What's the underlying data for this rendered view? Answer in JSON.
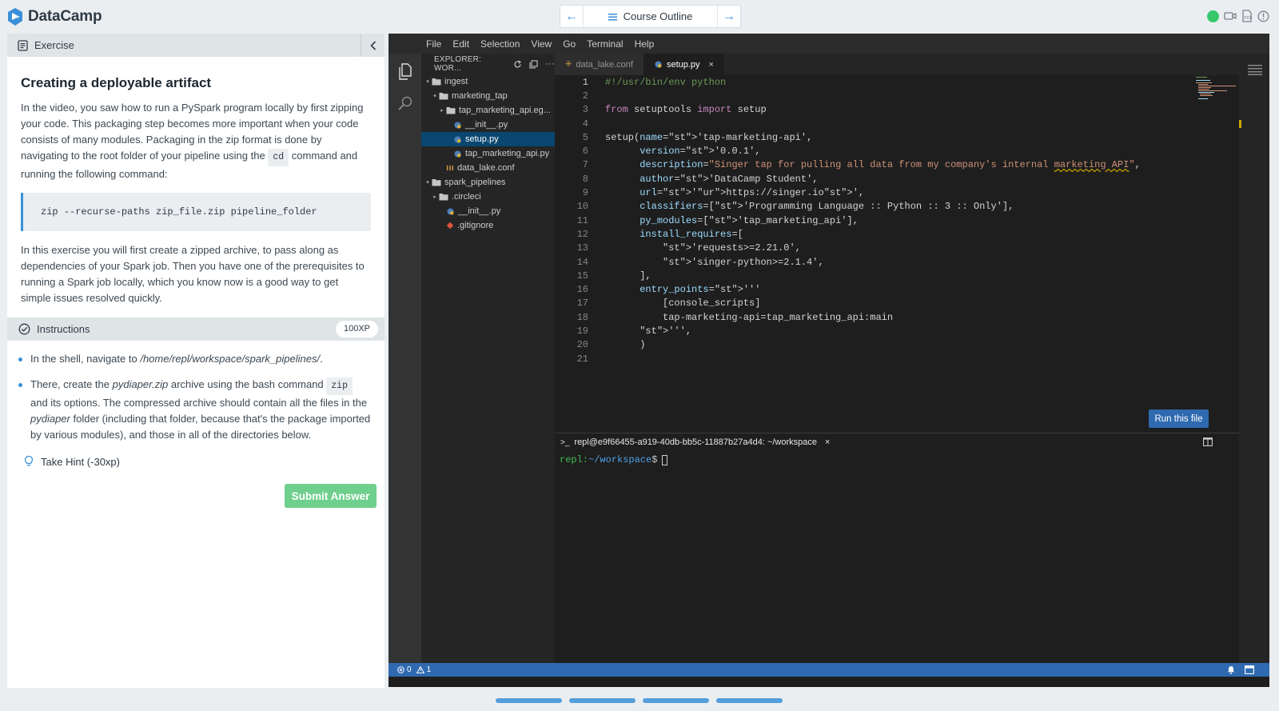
{
  "brand": {
    "name": "DataCamp",
    "accent": "#3a8fd8"
  },
  "topnav": {
    "course_outline": "Course Outline",
    "prev_icon": "arrow-left-icon",
    "next_icon": "arrow-right-icon"
  },
  "exercise": {
    "header": "Exercise",
    "title": "Creating a deployable artifact",
    "intro_parts": [
      "In the video, you saw how to run a PySpark program locally by first zipping your code. This packaging step becomes more important when your code consists of many modules. Packaging in the zip format is done by navigating to the root folder of your pipeline using the",
      "cd",
      "command and running the following command:"
    ],
    "command": "zip --recurse-paths zip_file.zip pipeline_folder",
    "body": "In this exercise you will first create a zipped archive, to pass along as dependencies of your Spark job. Then you have one of the prerequisites to running a Spark job locally, which you know now is a good way to get simple issues resolved quickly."
  },
  "instructions": {
    "header": "Instructions",
    "xp": "100XP",
    "b1_pre": "In the shell, navigate to",
    "b1_path": "/home/repl/workspace/spark_pipelines/",
    "b1_post": ".",
    "b2_a": "There, create the",
    "b2_file": "pydiaper.zip",
    "b2_b": "archive using the bash command",
    "b2_code": "zip",
    "b2_c": "and its options. The compressed archive should contain all the files in the",
    "b2_folder": "pydiaper",
    "b2_d": "folder (including that folder, because that's the package imported by various modules), and those in all of the directories below.",
    "hint": "Take Hint (-30xp)",
    "submit": "Submit Answer"
  },
  "ide": {
    "menu": [
      "File",
      "Edit",
      "Selection",
      "View",
      "Go",
      "Terminal",
      "Help"
    ],
    "explorer_title": "EXPLORER: WOR...",
    "tree": [
      {
        "label": "ingest",
        "indent": 0,
        "twisty": "▾",
        "type": "folder"
      },
      {
        "label": "marketing_tap",
        "indent": 1,
        "twisty": "▾",
        "type": "folder"
      },
      {
        "label": "tap_marketing_api.eg...",
        "indent": 2,
        "twisty": "▸",
        "type": "folder"
      },
      {
        "label": "__init__.py",
        "indent": 3,
        "twisty": "",
        "type": "py"
      },
      {
        "label": "setup.py",
        "indent": 3,
        "twisty": "",
        "type": "py",
        "selected": true
      },
      {
        "label": "tap_marketing_api.py",
        "indent": 3,
        "twisty": "",
        "type": "py"
      },
      {
        "label": "data_lake.conf",
        "indent": 2,
        "twisty": "",
        "type": "conf"
      },
      {
        "label": "spark_pipelines",
        "indent": 0,
        "twisty": "▾",
        "type": "folder"
      },
      {
        "label": ".circleci",
        "indent": 1,
        "twisty": "▸",
        "type": "folder"
      },
      {
        "label": "__init__.py",
        "indent": 2,
        "twisty": "",
        "type": "py"
      },
      {
        "label": ".gitignore",
        "indent": 2,
        "twisty": "",
        "type": "git"
      }
    ],
    "tabs": [
      {
        "label": "data_lake.conf",
        "active": false
      },
      {
        "label": "setup.py",
        "active": true
      }
    ],
    "code_lines": [
      "#!/usr/bin/env python",
      "",
      "from setuptools import setup",
      "",
      "setup(name='tap-marketing-api',",
      "      version='0.0.1',",
      "      description=\"Singer tap for pulling all data from my company's internal marketing API\",",
      "      author='DataCamp Student',",
      "      url='https://singer.io',",
      "      classifiers=['Programming Language :: Python :: 3 :: Only'],",
      "      py_modules=['tap_marketing_api'],",
      "      install_requires=[",
      "          'requests>=2.21.0',",
      "          'singer-python>=2.1.4',",
      "      ],",
      "      entry_points='''",
      "          [console_scripts]",
      "          tap-marketing-api=tap_marketing_api:main",
      "      ''',",
      "      )",
      ""
    ],
    "run_button": "Run this file",
    "terminal_tab": "repl@e9f66455-a919-40db-bb5c-11887b27a4d4: ~/workspace",
    "prompt_user": "repl:",
    "prompt_path": "~/workspace",
    "prompt_symbol": "$",
    "status_errors": "0",
    "status_warnings": "1"
  }
}
